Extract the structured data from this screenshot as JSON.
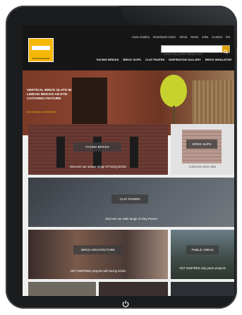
{
  "header": {
    "logo_text": "WIENERBERGER",
    "utility_links": [
      "Case studies",
      "Download center",
      "About",
      "News",
      "Jobs",
      "Contact",
      "EN"
    ],
    "search_placeholder": "Search my perfect facing brick...",
    "nav_items": [
      "FACING BRICKS",
      "BRICK SLIPS",
      "CLAY PAVERS",
      "INSPIRATION GALLERY",
      "BRICK SIMULATOR"
    ]
  },
  "hero": {
    "text": "VERTICAL BRICK SLATS IN LIMEAD BRICKS AN EYE-CATCHING FEATURE",
    "link": "by Doblado, Architecten"
  },
  "tiles": [
    {
      "label": "FACING BRICKS",
      "caption": "Discover our unique range of Facing bricks"
    },
    {
      "label": "BRICK SLIPS",
      "caption": "Collection Brick slips"
    },
    {
      "label": "CLAY PAVERS",
      "caption": "Discover our wide range of Clay Pavers"
    },
    {
      "label": "BRICK ARCHITECTURE",
      "caption": "GET INSPIRED projects with facing bricks"
    },
    {
      "label": "PUBLIC AREAS",
      "caption": "GET INSPIRED clay paver projects"
    }
  ],
  "colors": {
    "accent": "#f5b700",
    "topbar": "#161616",
    "bezel": "#1a1c1e"
  },
  "icons": {
    "search": "magnifier",
    "power": "power"
  }
}
